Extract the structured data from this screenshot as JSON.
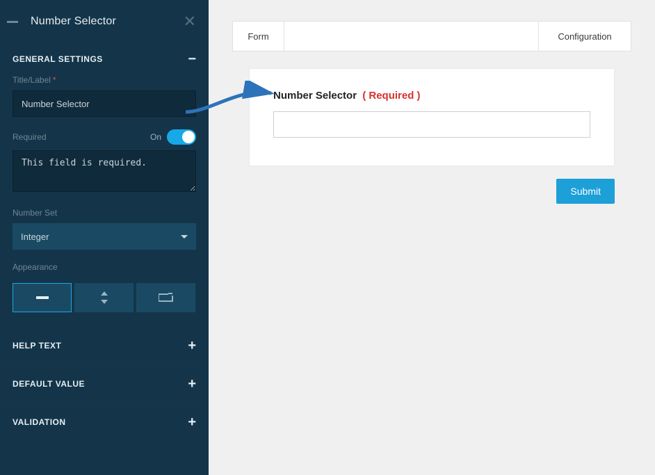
{
  "sidebar": {
    "title": "Number Selector",
    "general_settings_label": "GENERAL SETTINGS",
    "title_label": "Title/Label",
    "title_value": "Number Selector",
    "required_label": "Required",
    "required_state": "On",
    "required_message": "This field is required.",
    "number_set_label": "Number Set",
    "number_set_value": "Integer",
    "appearance_label": "Appearance",
    "sections": {
      "help_text": "HELP TEXT",
      "default_value": "DEFAULT VALUE",
      "validation": "VALIDATION"
    }
  },
  "main": {
    "tabs": {
      "form": "Form",
      "configuration": "Configuration"
    },
    "field_label": "Number Selector",
    "field_required_text": "( Required )",
    "submit_label": "Submit"
  }
}
